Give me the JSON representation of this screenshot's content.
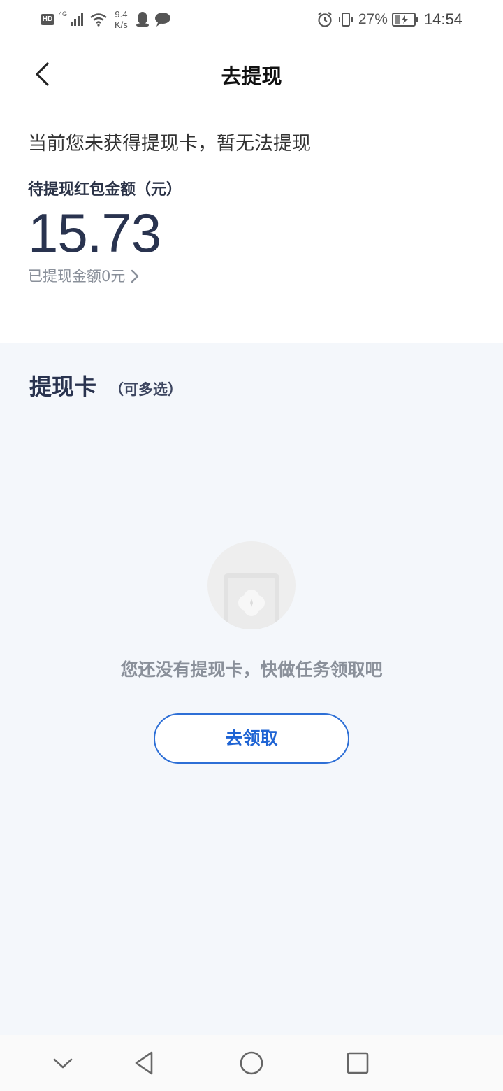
{
  "status_bar": {
    "hd": "HD",
    "network": "4G",
    "speed_value": "9.4",
    "speed_unit": "K/s",
    "battery": "27%",
    "time": "14:54"
  },
  "header": {
    "title": "去提现"
  },
  "info": {
    "notice": "当前您未获得提现卡，暂无法提现",
    "amount_label": "待提现红包金额（元）",
    "amount": "15.73",
    "withdrawn": "已提现金额0元"
  },
  "cards": {
    "title": "提现卡",
    "subtitle": "（可多选）",
    "empty_text": "您还没有提现卡，快做任务领取吧",
    "claim_button": "去领取"
  },
  "colors": {
    "accent": "#2d6fd6",
    "amount": "#29334f",
    "section_bg": "#f4f7fb",
    "muted_text": "#8a909a"
  },
  "icons": {
    "back": "chevron-left-icon",
    "withdrawn_arrow": "chevron-right-icon",
    "empty_state": "empty-card-illustration",
    "nav": [
      "chevron-down-icon",
      "back-triangle-icon",
      "home-circle-icon",
      "recents-square-icon"
    ]
  }
}
